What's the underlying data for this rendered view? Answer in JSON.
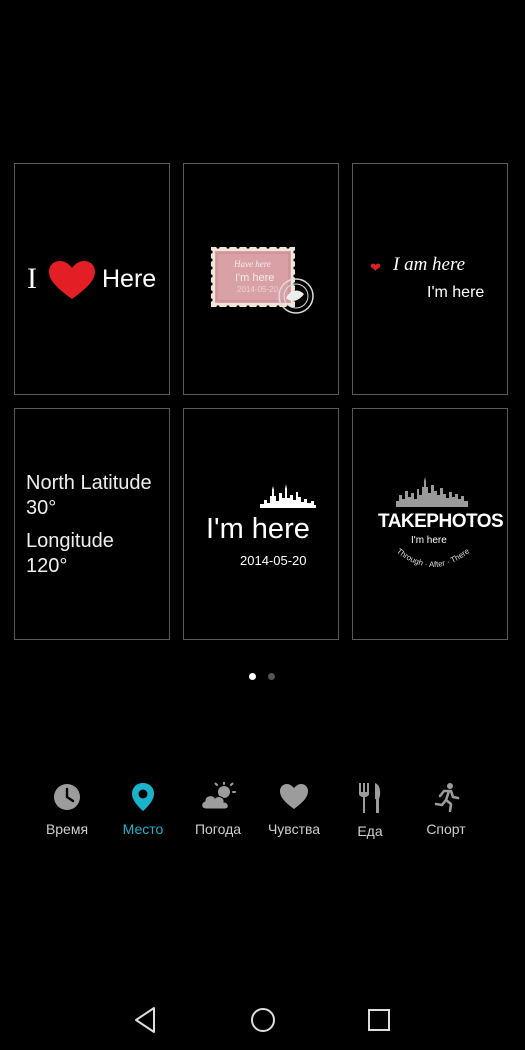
{
  "cards": {
    "heart_here": {
      "i": "I",
      "here": "Here"
    },
    "stamp": {
      "title": "Have here",
      "line": "I'm here",
      "date": "2014-05-20"
    },
    "script_here": {
      "script": "I am here",
      "sub": "I'm here"
    },
    "coordinates": {
      "lat_label": "North Latitude",
      "lat_value": "30°",
      "lon_label": "Longitude",
      "lon_value": "120°"
    },
    "skyline": {
      "title": "I'm here",
      "date": "2014-05-20"
    },
    "takephotos": {
      "brand": "TAKEPHOTOS",
      "sub": "I'm here",
      "arc_text": "Through · After · There"
    }
  },
  "pager": {
    "current": 1,
    "total": 2
  },
  "categories": [
    {
      "label": "Время",
      "icon": "clock-icon"
    },
    {
      "label": "Место",
      "icon": "location-pin-icon",
      "active": true
    },
    {
      "label": "Погода",
      "icon": "cloud-sun-icon"
    },
    {
      "label": "Чувства",
      "icon": "heart-icon"
    },
    {
      "label": "Еда",
      "icon": "fork-knife-icon"
    },
    {
      "label": "Спорт",
      "icon": "running-icon"
    }
  ],
  "colors": {
    "accent": "#1ab3cc",
    "heart_red": "#e31e24",
    "stamp_pink": "#d9a0a6"
  }
}
